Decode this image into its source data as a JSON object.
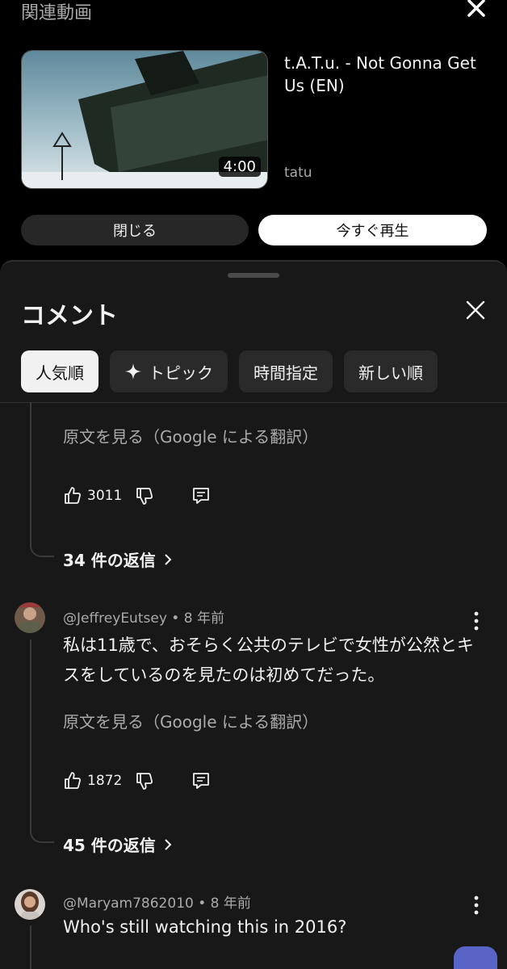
{
  "related": {
    "title": "関連動画",
    "video_title": "t.A.T.u. - Not Gonna Get Us (EN)",
    "channel": "tatu",
    "duration": "4:00",
    "close_label": "閉じる",
    "play_label": "今すぐ再生"
  },
  "comments": {
    "title": "コメント",
    "chips": [
      "人気順",
      "トピック",
      "時間指定",
      "新しい順"
    ],
    "items": [
      {
        "translate": "原文を見る（Google による翻訳）",
        "likes": "3011",
        "replies": "34 件の返信"
      },
      {
        "author": "@JeffreyEutsey",
        "age": "8 年前",
        "text": "私は11歳で、おそらく公共のテレビで女性が公然とキスをしているのを見たのは初めてだった。",
        "translate": "原文を見る（Google による翻訳）",
        "likes": "1872",
        "replies": "45 件の返信"
      },
      {
        "author": "@Maryam7862010",
        "age": "8 年前",
        "text": "Who's still watching this in 2016?"
      }
    ]
  },
  "colors": {
    "background": "#000000",
    "sheet": "#181818",
    "chip": "#2a2a2a",
    "accent_fab": "#5865c6"
  }
}
